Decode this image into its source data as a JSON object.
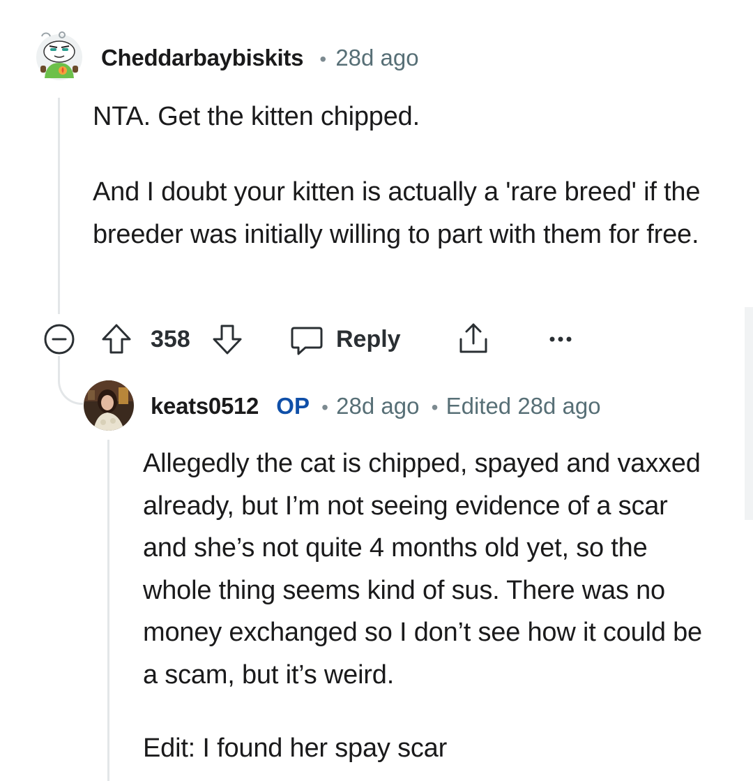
{
  "comment": {
    "username": "Cheddarbaybiskits",
    "separator": "•",
    "time": "28d ago",
    "paragraphs": [
      "NTA. Get the kitten chipped.",
      "And I doubt your kitten is actually a 'rare breed' if the breeder was initially willing to part with them for free."
    ],
    "actions": {
      "collapse_icon": "collapse-minus-icon",
      "upvote_icon": "upvote-arrow-icon",
      "score": "358",
      "downvote_icon": "downvote-arrow-icon",
      "reply_label": "Reply",
      "share_icon": "share-icon",
      "more_icon": "more-options-icon"
    }
  },
  "reply": {
    "username": "keats0512",
    "badge": "OP",
    "separator": "•",
    "time": "28d ago",
    "edited": "Edited 28d ago",
    "paragraphs": [
      "Allegedly the cat is chipped, spayed and vaxxed already, but I’m not seeing evidence of a scar and she’s not quite 4 months old yet, so the whole thing seems kind of sus. There was no money exchanged so I don’t see how it could be a scam, but it’s weird.",
      "Edit: I found her spay scar"
    ]
  },
  "colors": {
    "text": "#1a1a1b",
    "meta_gray": "#576f76",
    "op_blue": "#0f4fa8",
    "thread_line": "#e3e6e8"
  }
}
